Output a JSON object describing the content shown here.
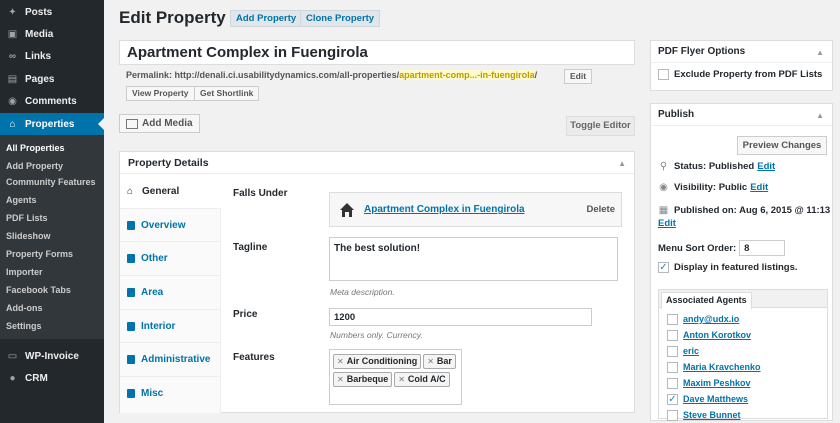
{
  "sidebar": {
    "top_items": [
      {
        "label": "Posts",
        "icon": "pin-icon"
      },
      {
        "label": "Media",
        "icon": "media-icon"
      },
      {
        "label": "Links",
        "icon": "link-icon"
      },
      {
        "label": "Pages",
        "icon": "page-icon"
      },
      {
        "label": "Comments",
        "icon": "comment-icon"
      }
    ],
    "current": {
      "label": "Properties",
      "icon": "home-icon"
    },
    "submenu": [
      "All Properties",
      "Add Property",
      "Community Features",
      "Agents",
      "PDF Lists",
      "Slideshow",
      "Property Forms",
      "Importer",
      "Facebook Tabs",
      "Add-ons",
      "Settings"
    ],
    "bottom_items": [
      {
        "label": "WP-Invoice",
        "icon": "invoice-icon"
      },
      {
        "label": "CRM",
        "icon": "crm-icon"
      }
    ]
  },
  "header": {
    "title": "Edit Property",
    "add_label": "Add Property",
    "clone_label": "Clone Property"
  },
  "post_title": "Apartment Complex in Fuengirola",
  "permalink": {
    "prefix": "Permalink: http://denali.ci.usabilitydynamics.com/all-properties/",
    "slug": "apartment-comp...-in-fuengirola",
    "suffix": "/",
    "edit": "Edit",
    "view": "View Property",
    "shortlink": "Get Shortlink"
  },
  "add_media": "Add Media",
  "toggle_editor": "Toggle Editor",
  "details": {
    "title": "Property Details",
    "tabs": [
      "General",
      "Overview",
      "Other",
      "Area",
      "Interior",
      "Administrative",
      "Misc"
    ],
    "falls_under_label": "Falls Under",
    "falls_under_value": "Apartment Complex in Fuengirola",
    "delete": "Delete",
    "tagline_label": "Tagline",
    "tagline_value": "The best solution!",
    "tagline_hint": "Meta description.",
    "price_label": "Price",
    "price_value": "1200",
    "price_hint": "Numbers only. Currency.",
    "features_label": "Features",
    "features": [
      "Air Conditioning",
      "Bar",
      "Barbeque",
      "Cold A/C"
    ]
  },
  "flyer": {
    "title": "PDF Flyer Options",
    "exclude_label": "Exclude Property from PDF Lists",
    "exclude_checked": false
  },
  "publish": {
    "title": "Publish",
    "preview": "Preview Changes",
    "status_label": "Status: Published",
    "visibility_label": "Visibility: Public",
    "published_label": "Published on: Aug 6, 2015 @ 11:13",
    "edit": "Edit",
    "sort_label": "Menu Sort Order:",
    "sort_value": "8",
    "featured_label": "Display in featured listings.",
    "featured_checked": true,
    "agents_tab": "Associated Agents",
    "agents": [
      {
        "name": "andy@udx.io",
        "checked": false
      },
      {
        "name": "Anton Korotkov",
        "checked": false
      },
      {
        "name": "eric",
        "checked": false
      },
      {
        "name": "Maria Kravchenko",
        "checked": false
      },
      {
        "name": "Maxim Peshkov",
        "checked": false
      },
      {
        "name": "Dave Matthews",
        "checked": true
      },
      {
        "name": "Steve Bunnet",
        "checked": false
      }
    ]
  },
  "colors": {
    "sidebar_bg": "#23282d",
    "accent": "#0073aa",
    "page_bg": "#f1f1f1"
  }
}
